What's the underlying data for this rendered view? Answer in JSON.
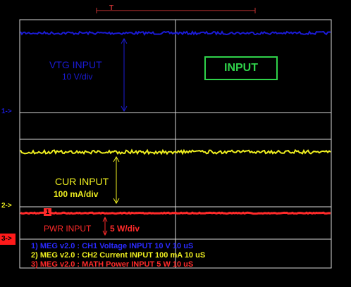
{
  "channels": {
    "vtg": {
      "label": "VTG INPUT",
      "scale": "10 V/div",
      "color": "#1b1bd6"
    },
    "cur": {
      "label": "CUR INPUT",
      "scale": "100 mA/div",
      "color": "#f0f020"
    },
    "pwr": {
      "label": "PWR INPUT",
      "scale": "5 W/div",
      "color": "#ff2a2a",
      "trace_marker": "1"
    }
  },
  "title_box": "INPUT",
  "markers": {
    "ch1": "1->",
    "ch2": "2->",
    "ch3": "3->",
    "trigger": "T"
  },
  "legend": [
    {
      "text": "1) MEG v2.0 : CH1 Voltage INPUT 10  V 10 uS",
      "color": "#2a2aff"
    },
    {
      "text": "2) MEG v2.0 : CH2 Current INPUT 100 mA 10 uS",
      "color": "#f0f020"
    },
    {
      "text": "3) MEG v2.0 : MATH Power INPUT 5  W 10 uS",
      "color": "#ff2a2a"
    }
  ]
}
